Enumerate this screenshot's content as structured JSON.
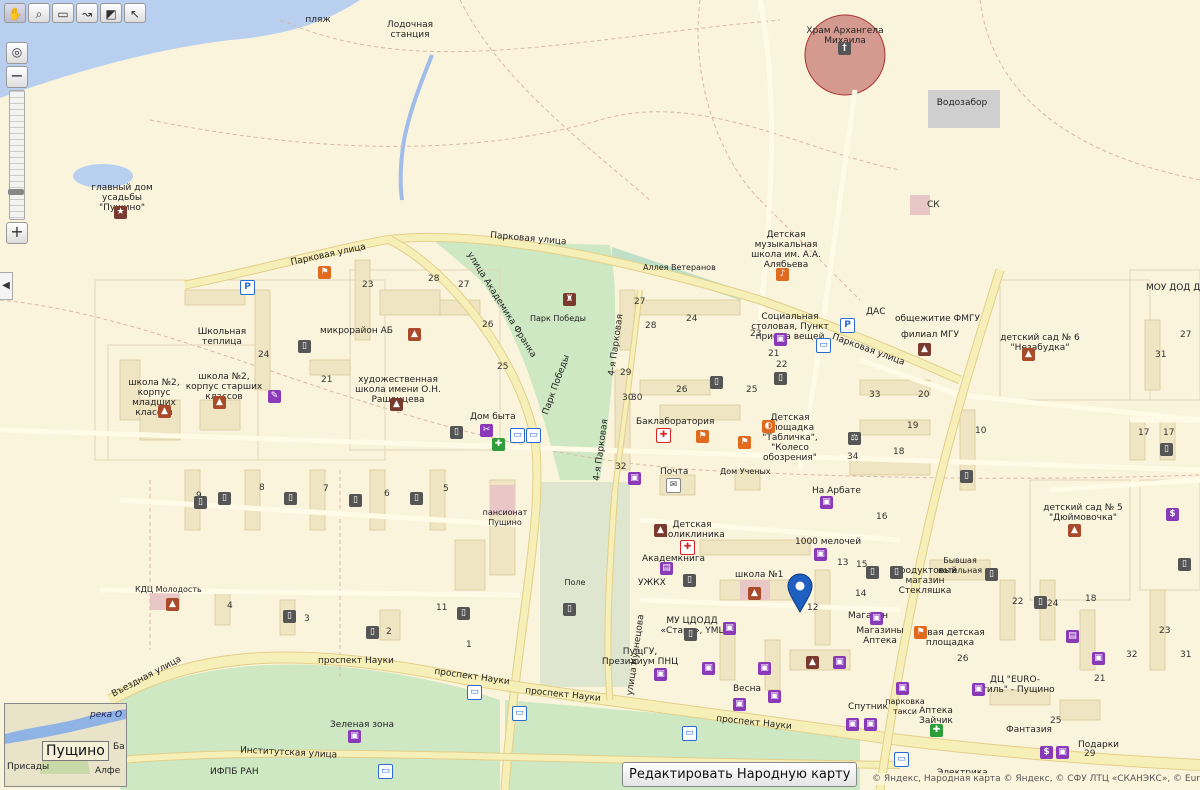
{
  "toolbar": {
    "tools": [
      "hand-tool",
      "zoom-area-tool",
      "ruler-tool",
      "route-tool",
      "layers-tool",
      "select-tool"
    ]
  },
  "zoom": {
    "plus": "+",
    "minus": "−",
    "level": 0.2
  },
  "minimap": {
    "river": "река О",
    "town": "Пущино",
    "left_label": "Присады",
    "right1": "Ба",
    "right2": "Алфе"
  },
  "edit_button": "Редактировать Народную карту",
  "attribution": "© Яндекс, Народная карта © Яндекс, © СФУ ЛТЦ «СКАНЭКС», © Europea",
  "labels": {
    "beach": "пляж",
    "boat_station": "Лодочная станция",
    "church": "Храм Архангела Михаила",
    "water_intake": "Водозабор",
    "manor": "главный дом усадьбы \"Пущино\"",
    "sk": "СК",
    "parkovaya": "Парковая улица",
    "academ_frank": "улица Академика Франка",
    "alley": "Аллея Ветеранов",
    "park_victory": "Парк Победы",
    "park_victory2": "Парк Победы",
    "fourth_park": "4-я Парковая",
    "fourth_park2": "4-я Парковая",
    "music_school": "Детская музыкальная школа им. А.А. Алябьева",
    "social": "Социальная столовая, Пункт приема вещей",
    "das": "ДАС",
    "dorm": "общежитие ФМГУ",
    "filial": "филиал МГУ",
    "kindergarten6": "детский сад № 6 \"Незабудка\"",
    "mou": "МОУ ДОД Дк",
    "parkovaya2": "Парковая улица",
    "school_greenhouse": "Школьная теплица",
    "microdistrict": "микрорайон АБ",
    "school2a": "школа №2, корпус старших классов",
    "school2b": "школа №2, корпус младших классов",
    "art_school": "художественная школа имени О.Н. Рашенцева",
    "dom_byta": "Дом быта",
    "bacteria": "Баклаборатория",
    "children_table": "Детская площадка \"Табличка\", \"Колесо обозрения\"",
    "pochta": "Почта",
    "scientists": "Дом Ученых",
    "arbat": "На Арбате",
    "pension": "пансионат Пущино",
    "children_clinic": "Детская поликлиника",
    "academkniga": "Академкнига",
    "uzhkh": "УЖКХ",
    "field": "Поле",
    "thousand": "1000 мелочей",
    "school1": "школа №1",
    "former_boiler": "Бывшая котельная",
    "grocery": "Продуктовый магазин Стекляшка",
    "kindergarten5": "детский сад № 5 \"Дюймовочка\"",
    "kdc": "КДЦ Молодость",
    "mu_start": "МУ ЦДОДД «Старт», YML",
    "pushgu": "ПущГУ, Президиум ПНЦ",
    "kuznetsova": "улица Кузнецова",
    "shop": "Магазин",
    "shops_pharmacy": "Магазины Аптека",
    "new_playground": "Новая детская площадка",
    "dc_euro": "ДЦ \"EURO-Стиль\" - Пущино",
    "vesna": "Весна",
    "sputnik": "Спутник",
    "taxi": "парковка такси",
    "pharmacy_zaychik": "Аптека Зайчик",
    "fantasy": "Фантазия",
    "gifts": "Подарки",
    "entrance": "Въездная улица",
    "prospekt1": "проспект Науки",
    "prospekt2": "проспект Науки",
    "prospekt3": "проспект Науки",
    "prospekt4": "проспект Науки",
    "green_zone": "Зеленая зона",
    "institutskaya": "Институтская улица",
    "ifpb": "ИФПБ РАН",
    "electric": "Электрика"
  },
  "numbers": [
    "28",
    "27",
    "26",
    "25",
    "23",
    "24",
    "21",
    "27",
    "28",
    "24",
    "29",
    "30",
    "26",
    "25",
    "23",
    "22",
    "21",
    "31",
    "32",
    "27",
    "20",
    "19",
    "18",
    "17",
    "16",
    "15",
    "14",
    "13",
    "12",
    "11",
    "10",
    "9",
    "8",
    "7",
    "6",
    "5",
    "4",
    "3",
    "2",
    "1",
    "33",
    "34",
    "31",
    "32",
    "17",
    "18",
    "21",
    "22",
    "23",
    "24",
    "25",
    "26",
    "29",
    "30"
  ],
  "colors": {
    "background": "#fbf4dc",
    "road": "#f7efb8",
    "road_edge": "#e3cf8a",
    "park": "#cde8c3",
    "river": "#b9cff0",
    "marker": "#1e5fc0",
    "church_circle": "#b45050"
  }
}
